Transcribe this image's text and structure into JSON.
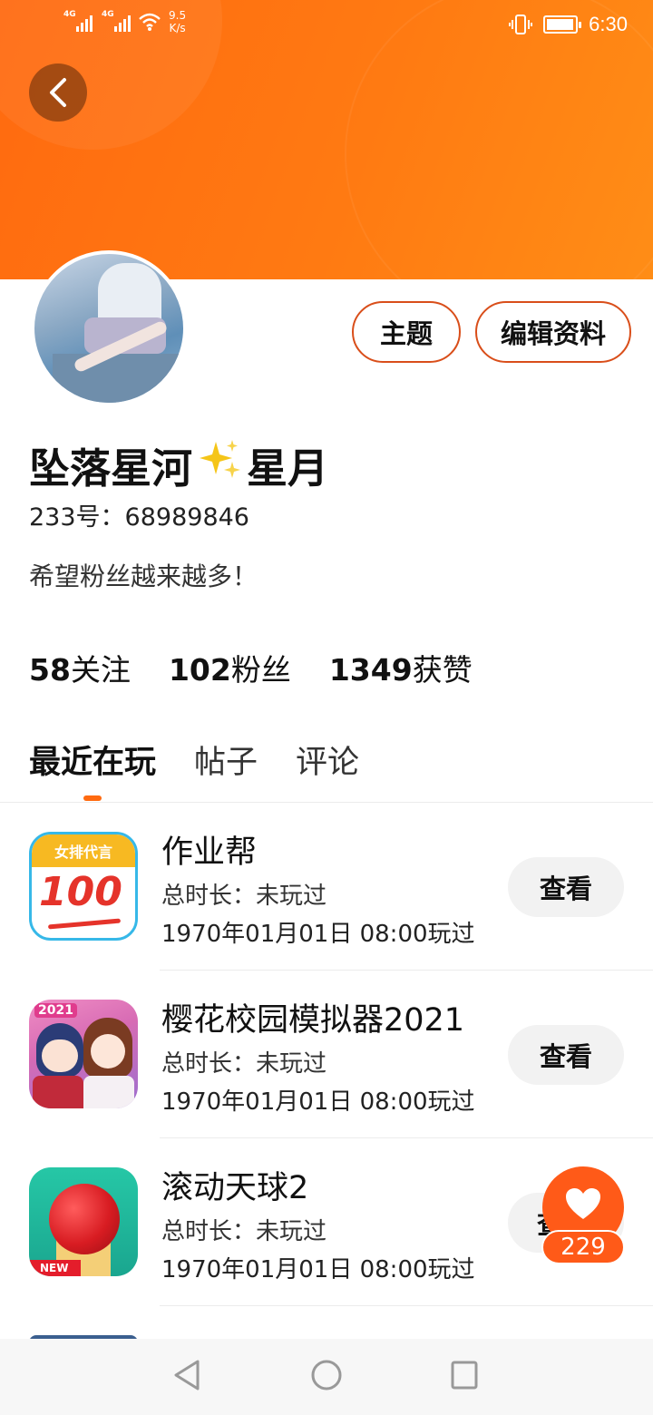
{
  "status_bar": {
    "network1": "4G",
    "network2": "4G",
    "speed_value": "9.5",
    "speed_unit": "K/s",
    "battery_level": 0.95,
    "time": "6:30"
  },
  "profile": {
    "name_part1": "坠落星河",
    "name_emoji": "sparkles-icon",
    "name_part2": "星月",
    "id_label": "233号：",
    "id_value": "68989846",
    "bio": "希望粉丝越来越多！",
    "actions": {
      "theme": "主题",
      "edit": "编辑资料"
    },
    "stats": [
      {
        "count": "58",
        "label": "关注"
      },
      {
        "count": "102",
        "label": "粉丝"
      },
      {
        "count": "1349",
        "label": "获赞"
      }
    ]
  },
  "tabs": [
    "最近在玩",
    "帖子",
    "评论"
  ],
  "active_tab": 0,
  "games": [
    {
      "title": "作业帮",
      "duration": "总时长：未玩过",
      "last_played": "1970年01月01日 08:00玩过",
      "button": "查看",
      "icon_text": "女排代言",
      "icon_number": "100"
    },
    {
      "title": "樱花校园模拟器2021",
      "duration": "总时长：未玩过",
      "last_played": "1970年01月01日 08:00玩过",
      "button": "查看",
      "icon_text": "2021"
    },
    {
      "title": "滚动天球2",
      "duration": "总时长：未玩过",
      "last_played": "1970年01月01日 08:00玩过",
      "button": "查",
      "icon_text": "NEW"
    }
  ],
  "like_fab": {
    "count": "229"
  },
  "colors": {
    "accent": "#ff6a10",
    "pill_border": "#d94e1a"
  }
}
